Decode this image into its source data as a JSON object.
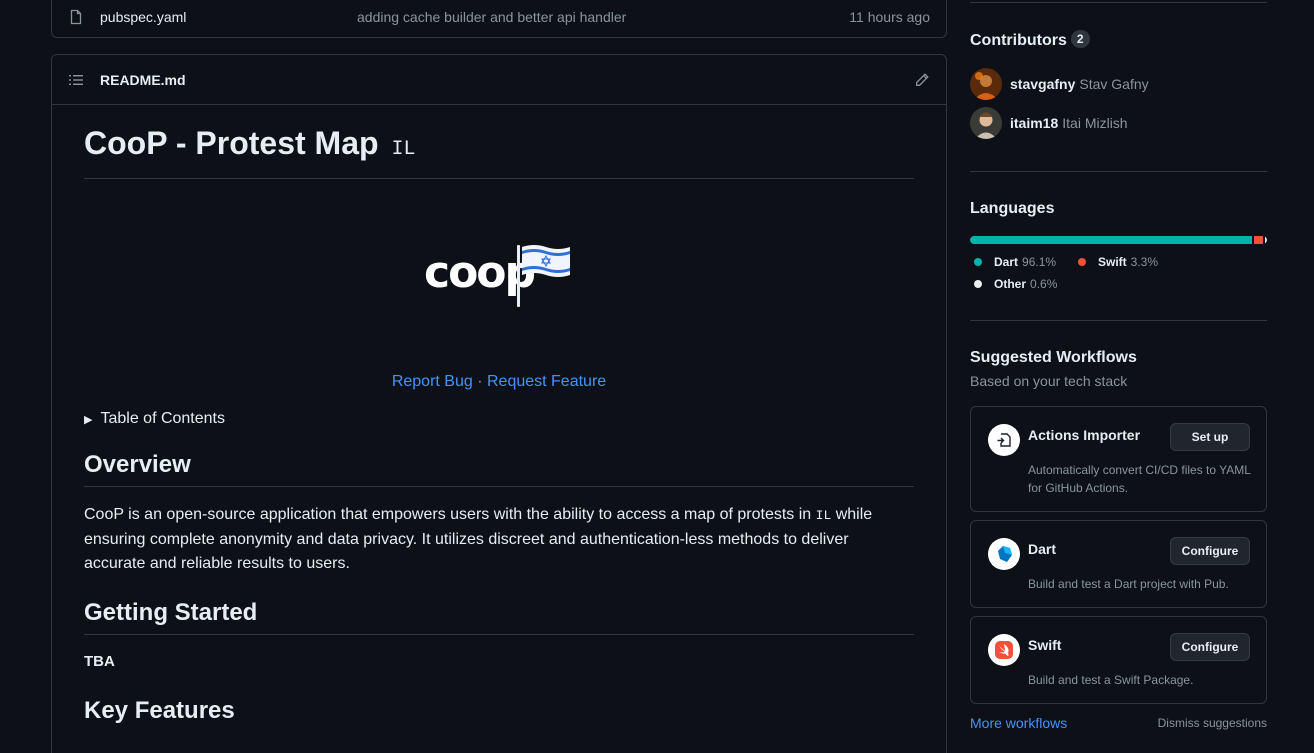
{
  "file_row": {
    "name": "pubspec.yaml",
    "commit": "adding cache builder and better api handler",
    "time": "11 hours ago"
  },
  "readme": {
    "filename": "README.md",
    "title": "CooP - Protest Map",
    "title_flag": "IL",
    "logo_text": "coop",
    "link_report": "Report Bug",
    "link_sep": "·",
    "link_request": "Request Feature",
    "toc_summary": "Table of Contents",
    "overview_heading": "Overview",
    "overview_text_1": "CooP is an open-source application that empowers users with the ability to access a map of protests in",
    "overview_flag": "IL",
    "overview_text_2": "while ensuring complete anonymity and data privacy. It utilizes discreet and authentication-less methods to deliver accurate and reliable results to users.",
    "getting_started_heading": "Getting Started",
    "tba": "TBA",
    "key_features_heading": "Key Features"
  },
  "sidebar": {
    "contributors_title": "Contributors",
    "contributors_count": "2",
    "contributors": [
      {
        "login": "stavgafny",
        "name": "Stav Gafny"
      },
      {
        "login": "itaim18",
        "name": "Itai Mizlish"
      }
    ],
    "languages_title": "Languages",
    "languages": [
      {
        "name": "Dart",
        "percent": "96.1%",
        "value": 96.1,
        "color": "#00B4AB"
      },
      {
        "name": "Swift",
        "percent": "3.3%",
        "value": 3.3,
        "color": "#F05138"
      },
      {
        "name": "Other",
        "percent": "0.6%",
        "value": 0.6,
        "color": "#ededed"
      }
    ],
    "workflows_title": "Suggested Workflows",
    "workflows_subtitle": "Based on your tech stack",
    "workflows": [
      {
        "name": "Actions Importer",
        "button": "Set up",
        "desc": "Automatically convert CI/CD files to YAML for GitHub Actions."
      },
      {
        "name": "Dart",
        "button": "Configure",
        "desc": "Build and test a Dart project with Pub."
      },
      {
        "name": "Swift",
        "button": "Configure",
        "desc": "Build and test a Swift Package."
      }
    ],
    "more_workflows": "More workflows",
    "dismiss": "Dismiss suggestions"
  }
}
